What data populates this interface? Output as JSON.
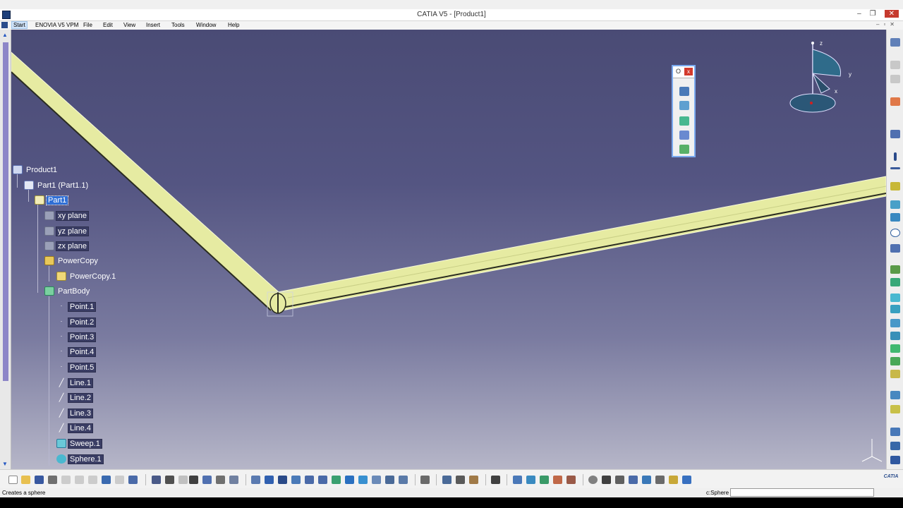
{
  "window": {
    "title": "CATIA V5 - [Product1]",
    "min_glyph": "–",
    "restore_glyph": "❐",
    "close_glyph": "✕"
  },
  "menu": {
    "items": [
      "Start",
      "ENOVIA V5 VPM",
      "File",
      "Edit",
      "View",
      "Insert",
      "Tools",
      "Window",
      "Help"
    ],
    "doc_controls": "–▫✕"
  },
  "tree": {
    "nodes": [
      {
        "label": "Product1",
        "icon": "product-icon"
      },
      {
        "label": "Part1 (Part1.1)",
        "icon": "part-instance-icon"
      },
      {
        "label": "Part1",
        "icon": "part-icon"
      },
      {
        "label": "xy plane",
        "icon": "plane-icon"
      },
      {
        "label": "yz plane",
        "icon": "plane-icon"
      },
      {
        "label": "zx plane",
        "icon": "plane-icon"
      },
      {
        "label": "PowerCopy",
        "icon": "powercopy-folder-icon"
      },
      {
        "label": "PowerCopy.1",
        "icon": "powercopy-icon"
      },
      {
        "label": "PartBody",
        "icon": "partbody-icon"
      },
      {
        "label": "Point.1",
        "icon": "point-icon"
      },
      {
        "label": "Point.2",
        "icon": "point-icon"
      },
      {
        "label": "Point.3",
        "icon": "point-icon"
      },
      {
        "label": "Point.4",
        "icon": "point-icon"
      },
      {
        "label": "Point.5",
        "icon": "point-icon"
      },
      {
        "label": "Line.1",
        "icon": "line-icon"
      },
      {
        "label": "Line.2",
        "icon": "line-icon"
      },
      {
        "label": "Line.3",
        "icon": "line-icon"
      },
      {
        "label": "Line.4",
        "icon": "line-icon"
      },
      {
        "label": "Sweep.1",
        "icon": "sweep-icon"
      },
      {
        "label": "Sphere.1",
        "icon": "sphere-icon"
      }
    ]
  },
  "floating_toolbar": {
    "title": "O",
    "close": "x"
  },
  "compass": {
    "z": "z",
    "y": "y",
    "x": "x"
  },
  "status": {
    "message": "Creates a sphere",
    "command_label": "c:Sphere",
    "command_value": ""
  },
  "logo": "CATIA",
  "colors": {
    "tube_fill": "#e6eba2",
    "tube_edge": "#2a2c20",
    "background_top": "#4a4b75",
    "background_bottom": "#b6b6c8",
    "selection": "#2f6fd6"
  }
}
